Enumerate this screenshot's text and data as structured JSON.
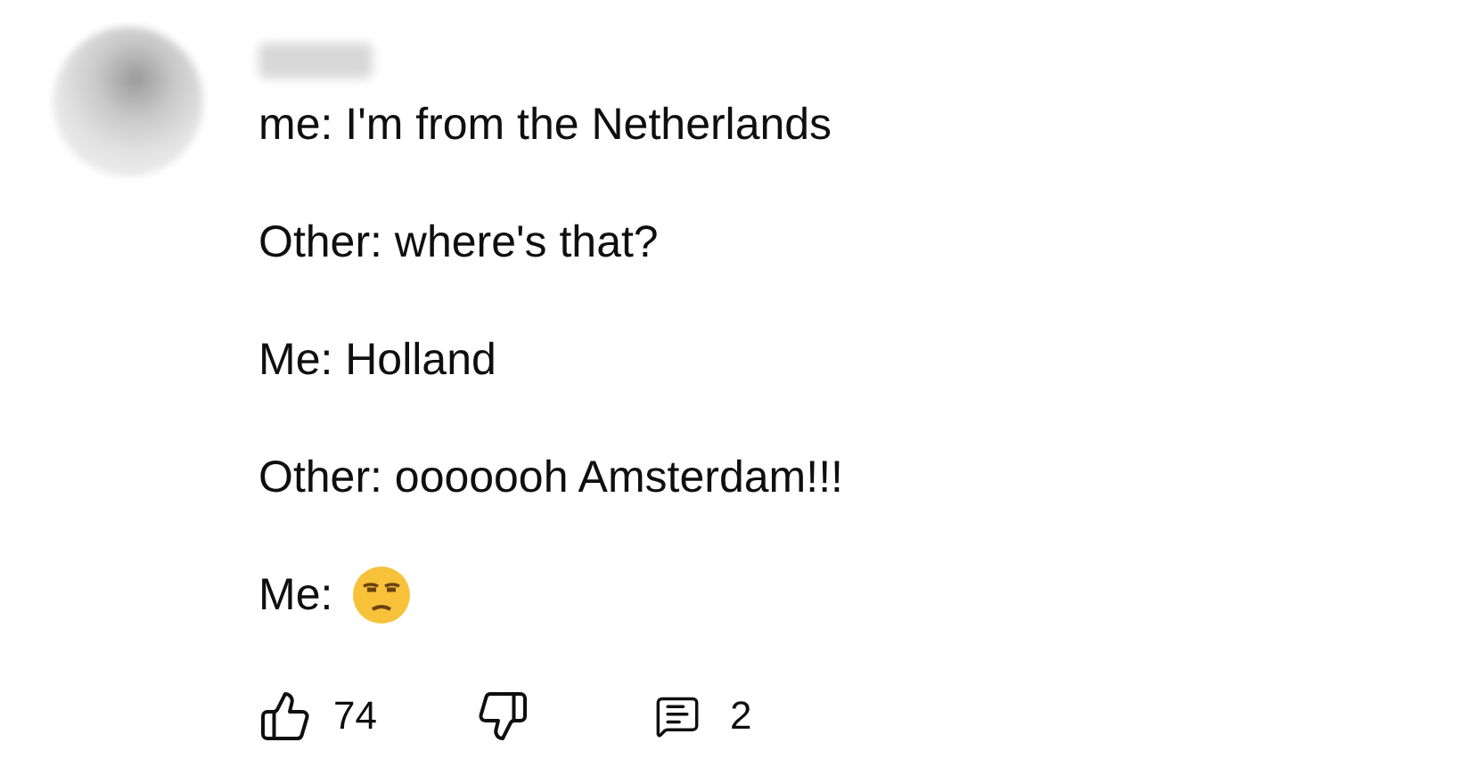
{
  "comment": {
    "lines": [
      {
        "kind": "text",
        "text": "me: I'm from the Netherlands"
      },
      {
        "kind": "text",
        "text": "Other: where's that?"
      },
      {
        "kind": "text",
        "text": "Me: Holland"
      },
      {
        "kind": "text",
        "text": "Other: ooooooh Amsterdam!!!"
      },
      {
        "kind": "emoji",
        "text": "Me:"
      }
    ],
    "likes": "74",
    "replies": "2"
  }
}
